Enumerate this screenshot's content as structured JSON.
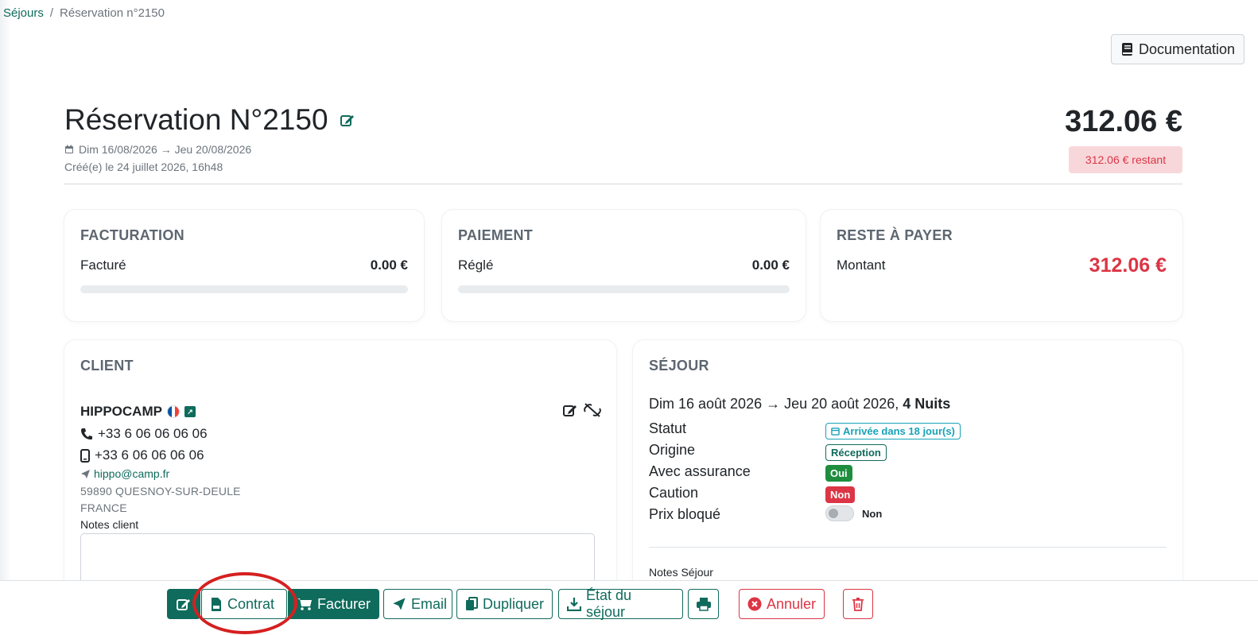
{
  "breadcrumb": {
    "parent": "Séjours",
    "separator": "/",
    "current": "Réservation n°2150"
  },
  "doc_button": {
    "label": "Documentation",
    "icon": "book-icon"
  },
  "header": {
    "title": "Réservation N°2150",
    "dates": "Dim 16/08/2026 → Jeu 20/08/2026",
    "created": "Créé(e) le 24 juillet 2026, 16h48",
    "total": "312.06 €",
    "remaining_badge": "312.06 € restant"
  },
  "summary": {
    "facturation": {
      "title": "FACTURATION",
      "label": "Facturé",
      "value": "0.00 €",
      "progress": 0
    },
    "paiement": {
      "title": "PAIEMENT",
      "label": "Réglé",
      "value": "0.00 €",
      "progress": 0
    },
    "reste": {
      "title": "RESTE À PAYER",
      "label": "Montant",
      "value": "312.06 €"
    }
  },
  "client": {
    "title": "CLIENT",
    "name": "HIPPOCAMP",
    "phone": "+33 6 06 06 06 06",
    "mobile": "+33 6 06 06 06 06",
    "email": "hippo@camp.fr",
    "city": "59890 QUESNOY-SUR-DEULE",
    "country": "FRANCE",
    "notes_label": "Notes client",
    "notes_value": ""
  },
  "sejour": {
    "title": "SÉJOUR",
    "dates": "Dim 16 août 2026 → Jeu 20 août 2026,",
    "nights": "4 Nuits",
    "statut_label": "Statut",
    "statut_value": "Arrivée dans 18 jour(s)",
    "origine_label": "Origine",
    "origine_value": "Réception",
    "assurance_label": "Avec assurance",
    "assurance_value": "Oui",
    "caution_label": "Caution",
    "caution_value": "Non",
    "prix_label": "Prix bloqué",
    "prix_value": "Non",
    "notes_label": "Notes Séjour"
  },
  "actions": {
    "contrat": "Contrat",
    "facturer": "Facturer",
    "email": "Email",
    "dupliquer": "Dupliquer",
    "etat": "État du séjour",
    "annuler": "Annuler"
  },
  "colors": {
    "brand": "#0f6b5c",
    "danger": "#dc3545",
    "info": "#17a2b8",
    "success": "#1e8e3e"
  }
}
